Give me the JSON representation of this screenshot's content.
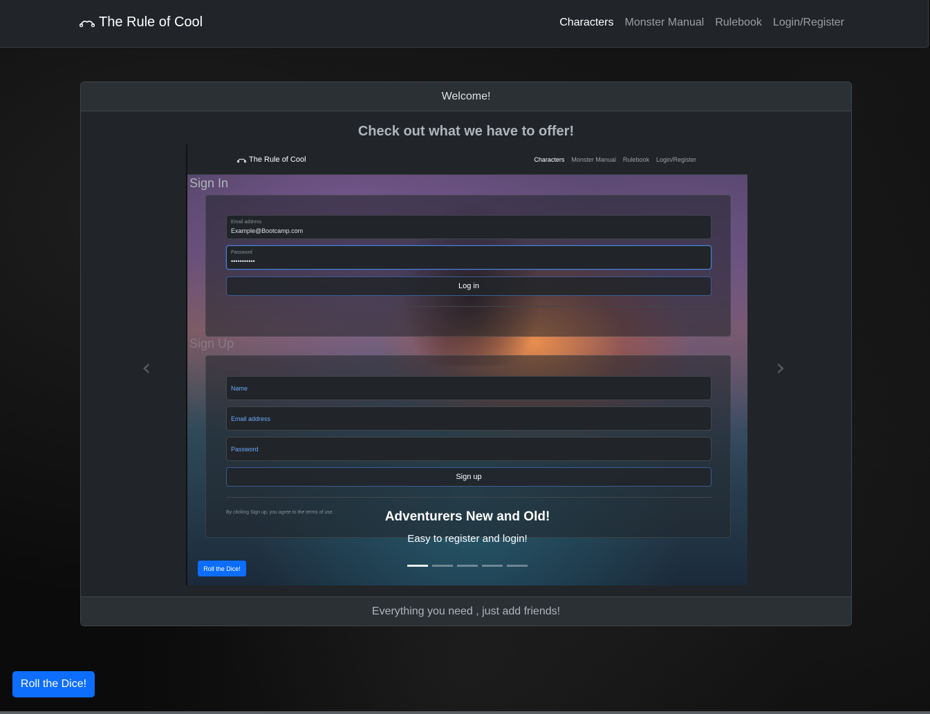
{
  "navbar": {
    "brand": "The Rule of Cool",
    "brand_icon": "dice-bones-icon",
    "links": [
      "Characters",
      "Monster Manual",
      "Rulebook",
      "Login/Register"
    ]
  },
  "card": {
    "header": "Welcome!",
    "title": "Check out what we have to offer!",
    "footer": "Everything you need , just add friends!"
  },
  "carousel": {
    "prev_icon": "chevron-left-icon",
    "next_icon": "chevron-right-icon",
    "caption_heading": "Adventurers New and Old!",
    "caption_text": "Easy to register and login!",
    "slide_count": 5,
    "active_slide": 1,
    "slide": {
      "brand": "The Rule of Cool",
      "links": [
        "Characters",
        "Monster Manual",
        "Rulebook",
        "Login/Register"
      ],
      "sign_in": {
        "title": "Sign In",
        "email_label": "Email address",
        "email_value": "Example@Bootcamp.com",
        "password_label": "Password",
        "password_value": "•••••••••••",
        "button": "Log in"
      },
      "sign_up": {
        "title": "Sign Up",
        "name_placeholder": "Name",
        "email_placeholder": "Email address",
        "password_placeholder": "Password",
        "button": "Sign up",
        "terms": "By clicking Sign up, you agree to the terms of use."
      },
      "dice_button": "Roll the Dice!"
    }
  },
  "dice_button": "Roll the Dice!",
  "colors": {
    "primary": "#0d6efd",
    "navbar_bg": "#212529",
    "card_bg": "#212529"
  }
}
